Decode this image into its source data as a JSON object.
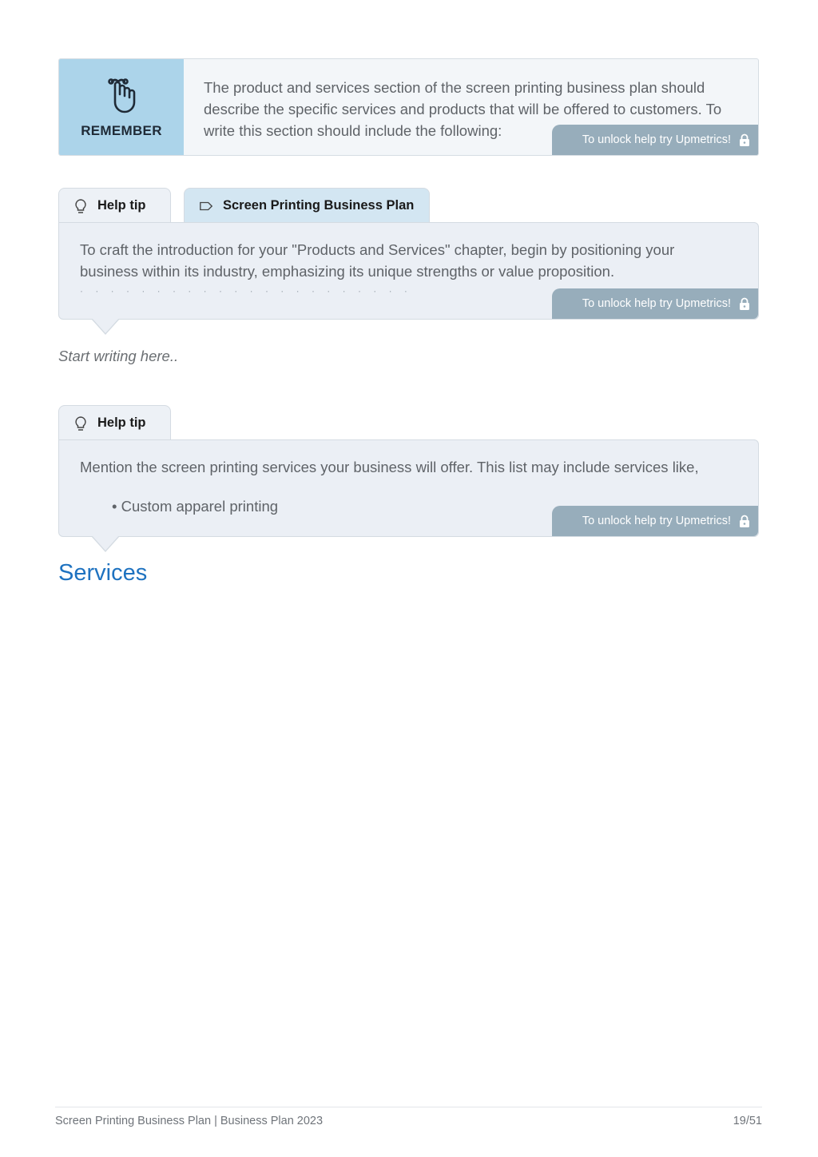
{
  "remember": {
    "label": "REMEMBER",
    "icon": "finger-string-icon",
    "text": "The product and services section of the screen printing business plan should describe the specific services and products that will be offered to customers. To write this section should include the following:",
    "unlock_label": "To unlock help try Upmetrics!"
  },
  "tip1": {
    "tabs": [
      {
        "label": "Help tip",
        "icon": "lightbulb-icon"
      },
      {
        "label": "Screen Printing Business Plan",
        "icon": "tag-icon"
      }
    ],
    "text": "To craft the introduction for your \"Products and Services\" chapter, begin by positioning your business within its industry, emphasizing its unique strengths or value proposition.",
    "unlock_label": "To unlock help try Upmetrics!"
  },
  "editor": {
    "placeholder": "Start writing here.."
  },
  "tip2": {
    "tabs": [
      {
        "label": "Help tip",
        "icon": "lightbulb-icon"
      }
    ],
    "text": "Mention the screen printing services your business will offer. This list may include services like,",
    "bullets": [
      "• Custom apparel printing"
    ],
    "unlock_label": "To unlock help try Upmetrics!"
  },
  "section": {
    "heading": "Services"
  },
  "footer": {
    "title": "Screen Printing Business Plan | Business Plan 2023",
    "page": "19/51"
  },
  "colors": {
    "accent": "#1e72c0",
    "remember_bg": "#acd4ea",
    "unlock_bg": "#97adbb",
    "tip_bg": "#ebeff5"
  }
}
